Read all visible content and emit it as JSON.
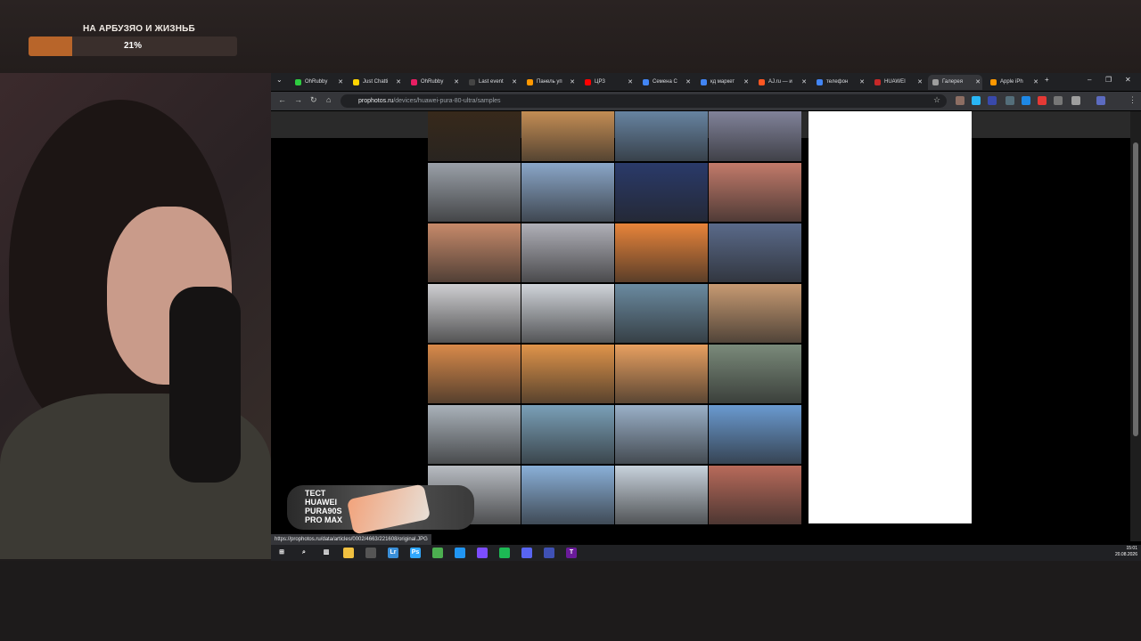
{
  "stream": {
    "goal_title": "НА АРБУЗЯО И ЖИЗНЬБ",
    "goal_progress": 0.21,
    "goal_percent": "21%",
    "promo_text": "ТЕСТ\nHUAWEI\nPURA90S\nPRO MAX"
  },
  "browser": {
    "tabs": [
      {
        "label": "OhRubby",
        "color": "#2ecc40"
      },
      {
        "label": "Just Chatti",
        "color": "#ffd400"
      },
      {
        "label": "OhRubby",
        "color": "#e91e63"
      },
      {
        "label": "Last event",
        "color": "#444444"
      },
      {
        "label": "Панель уп",
        "color": "#ff9800"
      },
      {
        "label": "ЦРЗ",
        "color": "#ff0000"
      },
      {
        "label": "Семена С",
        "color": "#4285f4"
      },
      {
        "label": "кд маркет",
        "color": "#4285f4"
      },
      {
        "label": "AJ.ru — и",
        "color": "#ff5722"
      },
      {
        "label": "телефон",
        "color": "#4285f4"
      },
      {
        "label": "HUAWEI",
        "color": "#c62828"
      },
      {
        "label": "Галерея",
        "color": "#9e9e9e",
        "active": true
      },
      {
        "label": "Apple iPh",
        "color": "#ff9800"
      }
    ],
    "url_domain": "prophotos.ru",
    "url_path": "/devices/huawei-pura-80-ultra/samples",
    "status_link": "https://prophotos.ru/data/articles/0002/4663/221608/original.JPG",
    "gallery_colors": [
      [
        "#3a2a1a",
        "#d79a5a",
        "#6f8fb0",
        "#8c8ea8"
      ],
      [
        "#9aa0a8",
        "#8aa6c8",
        "#2a3a6a",
        "#c27a6a"
      ],
      [
        "#c78a6a",
        "#b0b0b8",
        "#e8843a",
        "#5a6a8a"
      ],
      [
        "#cfcfd2",
        "#d0d4da",
        "#6a8aa0",
        "#c79a72"
      ],
      [
        "#d98a4a",
        "#e0944a",
        "#e8a060",
        "#7a8a7a"
      ],
      [
        "#aab2ba",
        "#7aa0b8",
        "#9ab0c8",
        "#6a9ad0"
      ],
      [
        "#b8bcc2",
        "#8ab0d8",
        "#c8d2dc",
        "#b86a5a"
      ]
    ]
  },
  "taskbar": {
    "icons": [
      {
        "name": "windows-start",
        "glyph": "⊞",
        "color": "#ffffff"
      },
      {
        "name": "search",
        "glyph": "⌕",
        "color": "#ffffff"
      },
      {
        "name": "task-view",
        "glyph": "▥",
        "color": "#ffffff"
      },
      {
        "name": "file-explorer",
        "glyph": "",
        "color": "#f0c040"
      },
      {
        "name": "obs",
        "glyph": "",
        "color": "#555555"
      },
      {
        "name": "lightroom",
        "glyph": "Lr",
        "color": "#3a8fd8"
      },
      {
        "name": "photoshop",
        "glyph": "Ps",
        "color": "#31a8ff"
      },
      {
        "name": "chrome",
        "glyph": "",
        "color": "#4caf50"
      },
      {
        "name": "browser",
        "glyph": "",
        "color": "#2196f3"
      },
      {
        "name": "app-grid",
        "glyph": "",
        "color": "#7c4dff"
      },
      {
        "name": "spotify",
        "glyph": "",
        "color": "#1db954"
      },
      {
        "name": "discord",
        "glyph": "",
        "color": "#5865f2"
      },
      {
        "name": "stats",
        "glyph": "",
        "color": "#3f51b5"
      },
      {
        "name": "typora",
        "glyph": "T",
        "color": "#6a1b9a"
      }
    ],
    "time": "15:01",
    "date": "20.08.2026"
  }
}
